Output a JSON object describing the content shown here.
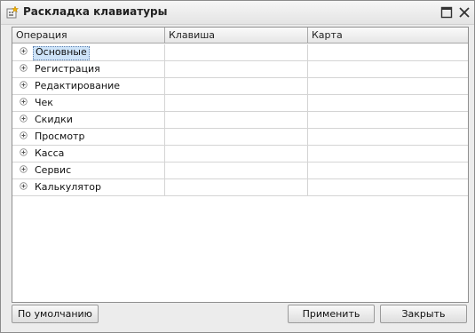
{
  "window": {
    "title": "Раскладка клавиатуры",
    "icons": {
      "app": "keyboard-app-icon",
      "maximize": "maximize-icon",
      "close": "close-icon"
    }
  },
  "table": {
    "columns": [
      "Операция",
      "Клавиша",
      "Карта"
    ],
    "rows": [
      {
        "operation": "Основные",
        "key": "",
        "card": "",
        "selected": true
      },
      {
        "operation": "Регистрация",
        "key": "",
        "card": ""
      },
      {
        "operation": "Редактирование",
        "key": "",
        "card": ""
      },
      {
        "operation": "Чек",
        "key": "",
        "card": ""
      },
      {
        "operation": "Скидки",
        "key": "",
        "card": ""
      },
      {
        "operation": "Просмотр",
        "key": "",
        "card": ""
      },
      {
        "operation": "Касса",
        "key": "",
        "card": ""
      },
      {
        "operation": "Сервис",
        "key": "",
        "card": ""
      },
      {
        "operation": "Калькулятор",
        "key": "",
        "card": ""
      }
    ]
  },
  "buttons": {
    "default_label": "По умолчанию",
    "apply_label": "Применить",
    "close_label": "Закрыть"
  }
}
